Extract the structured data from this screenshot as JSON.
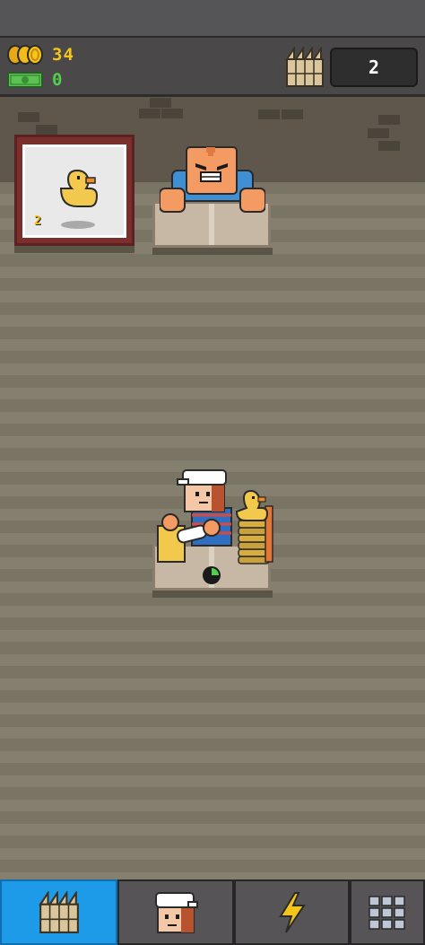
{
  "hud": {
    "coins": "34",
    "cash": "0",
    "level": "2",
    "icons": [
      "coins-icon",
      "cash-icon",
      "factory-icon"
    ]
  },
  "display_case": {
    "item": "rubber-duck",
    "count": "2"
  },
  "customer_counter": {
    "character": "angry-customer"
  },
  "worker_station": {
    "character": "worker-with-cap",
    "stack_item": "rubber-duck",
    "progress": 0.25
  },
  "tabbar": {
    "tabs": [
      {
        "icon": "factory-icon",
        "active": true
      },
      {
        "icon": "worker-icon",
        "active": false
      },
      {
        "icon": "lightning-icon",
        "active": false
      },
      {
        "icon": "grid-icon",
        "active": false
      }
    ]
  },
  "colors": {
    "coin": "#f5c518",
    "cash": "#4fd14a",
    "active_tab": "#1e9be8",
    "duck": "#f2c94c"
  }
}
